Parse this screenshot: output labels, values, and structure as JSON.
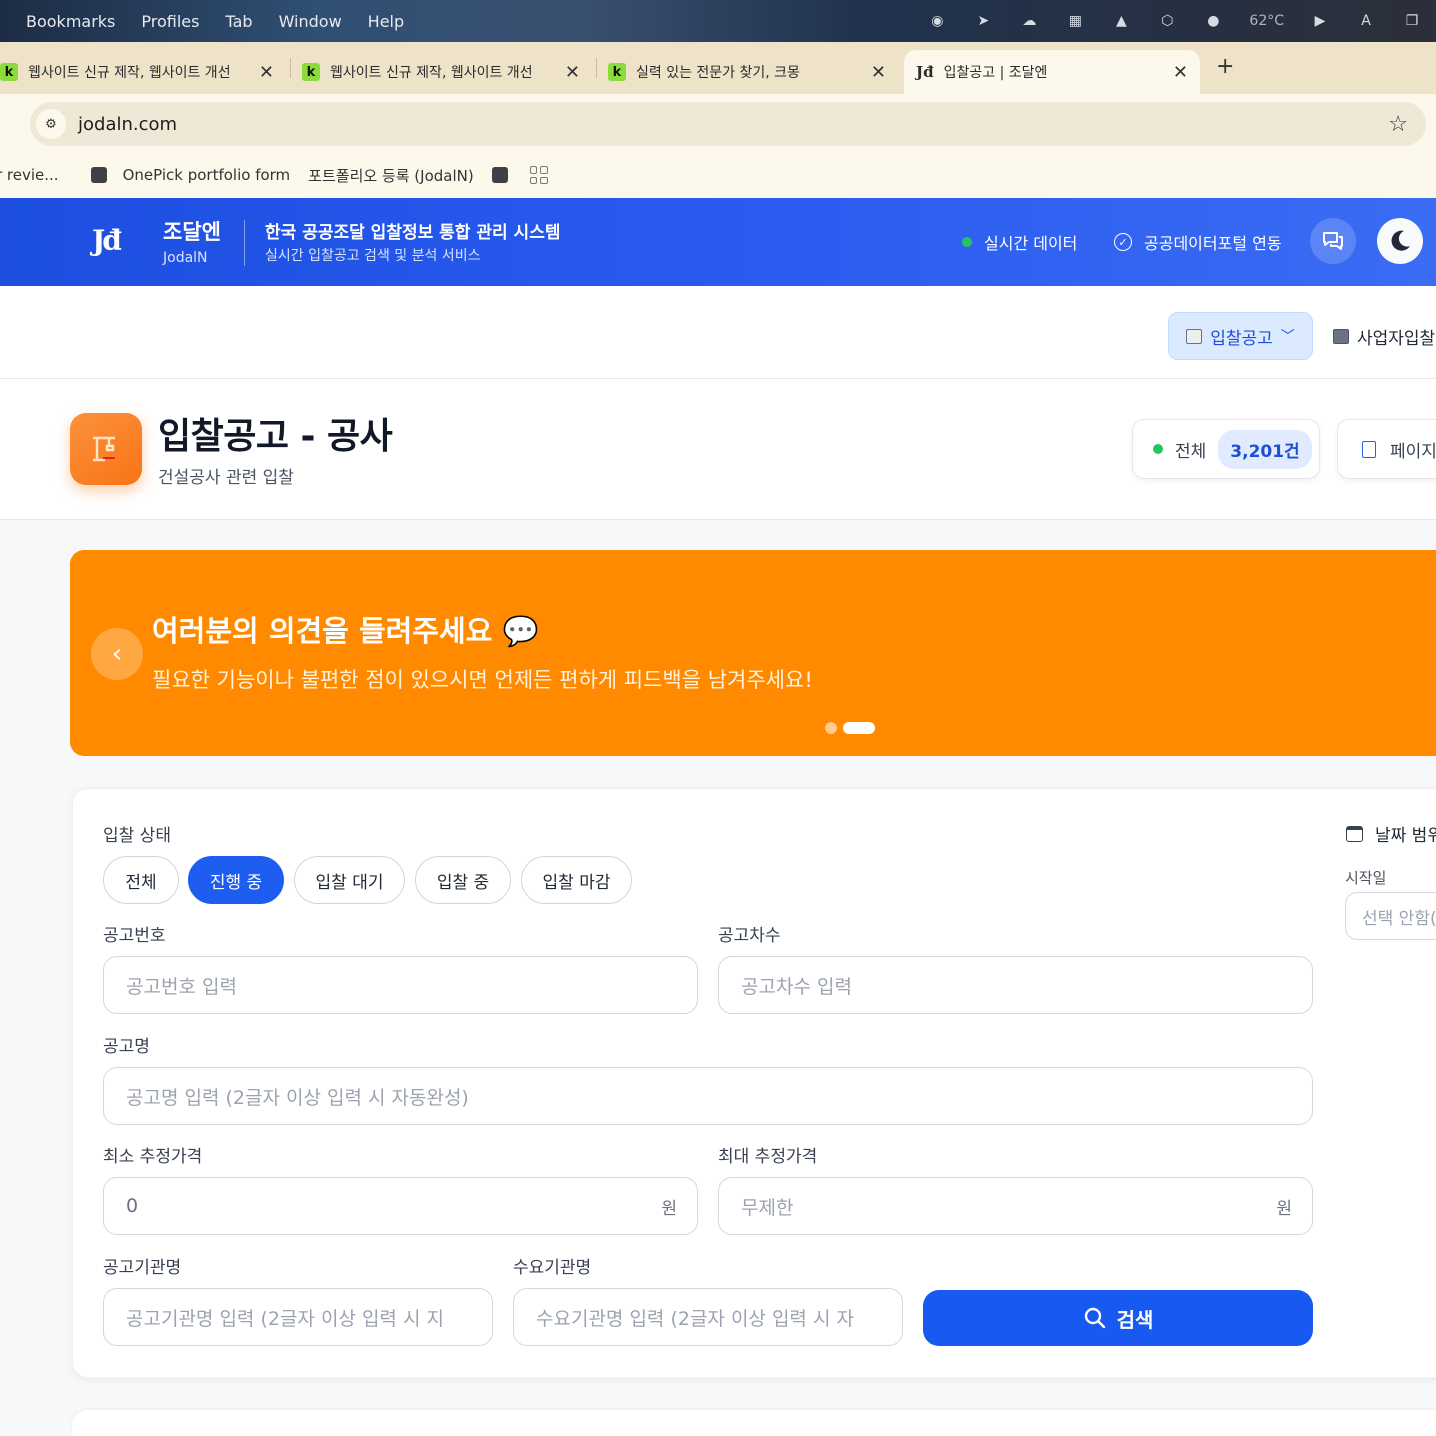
{
  "menubar": {
    "items": [
      "Bookmarks",
      "Profiles",
      "Tab",
      "Window",
      "Help"
    ],
    "temperature": "62°C"
  },
  "tabs": [
    {
      "title": "웹사이트 신규 제작, 웹사이트 개선",
      "favicon": "k"
    },
    {
      "title": "웹사이트 신규 제작, 웹사이트 개선",
      "favicon": "k"
    },
    {
      "title": "실력 있는 전문가 찾기, 크몽",
      "favicon": "k"
    },
    {
      "title": "입찰공고 | 조달엔",
      "favicon": "jodaln-logo"
    }
  ],
  "omnibox": {
    "url": "jodaln.com"
  },
  "bookmarks": {
    "items": [
      "r revie...",
      "OnePick portfolio form",
      "포트폴리오 등록 (JodalN)"
    ]
  },
  "header": {
    "brand_name": "조달엔",
    "brand_sub": "JodalN",
    "system_title": "한국 공공조달 입찰정보 통합 관리 시스템",
    "system_sub": "실시간 입찰공고 검색 및 분석 서비스",
    "realtime": "실시간 데이터",
    "portal": "공공데이터포털 연동"
  },
  "nav": {
    "bid_notice": "입찰공고",
    "business_bid": "사업자입찰"
  },
  "page": {
    "title": "입찰공고 - 공사",
    "subtitle": "건설공사 관련 입찰",
    "total_label": "전체",
    "total_count": "3,201건",
    "page_label": "페이지"
  },
  "banner": {
    "title": "여러분의 의견을 들려주세요 💬",
    "text": "필요한 기능이나 불편한 점이 있으시면 언제든 편하게 피드백을 남겨주세요!"
  },
  "filters": {
    "status_label": "입찰 상태",
    "status_options": [
      "전체",
      "진행 중",
      "입찰 대기",
      "입찰 중",
      "입찰 마감"
    ],
    "notice_no_label": "공고번호",
    "notice_no_placeholder": "공고번호 입력",
    "notice_round_label": "공고차수",
    "notice_round_placeholder": "공고차수 입력",
    "notice_name_label": "공고명",
    "notice_name_placeholder": "공고명 입력 (2글자 이상 입력 시 자동완성)",
    "min_price_label": "최소 추정가격",
    "min_price_value": "0",
    "max_price_label": "최대 추정가격",
    "max_price_placeholder": "무제한",
    "currency_unit": "원",
    "agency_label": "공고기관명",
    "agency_placeholder": "공고기관명 입력 (2글자 이상 입력 시 지",
    "demand_label": "수요기관명",
    "demand_placeholder": "수요기관명 입력 (2글자 이상 입력 시 자",
    "search_button": "검색",
    "date_range_label": "날짜 범위",
    "start_date_label": "시작일",
    "start_date_placeholder": "선택 안함(전"
  },
  "colors": {
    "primary": "#1d5df0",
    "header_blue": "#2a5cf0",
    "banner_orange": "#ff8a00",
    "status_green": "#22c55e"
  }
}
